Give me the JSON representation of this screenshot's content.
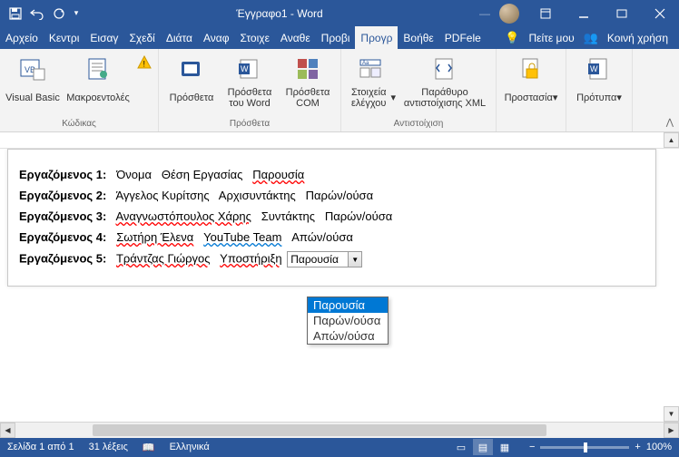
{
  "titlebar": {
    "title": "Έγγραφο1 - Word",
    "username": "—"
  },
  "tabs": [
    "Αρχείο",
    "Κεντρι",
    "Εισαγ",
    "Σχεδί",
    "Διάτα",
    "Αναφ",
    "Στοιχε",
    "Αναθε",
    "Προβι",
    "Προγρ",
    "Βοήθε",
    "PDFele"
  ],
  "activeTab": 9,
  "tell_me": "Πείτε μου",
  "share": "Κοινή χρήση",
  "ribbon": {
    "groups": [
      {
        "label": "Κώδικας",
        "buttons": [
          {
            "name": "visual-basic",
            "label": "Visual Basic"
          },
          {
            "name": "macros",
            "label": "Μακροεντολές"
          },
          {
            "name": "macro-security",
            "label": ""
          }
        ]
      },
      {
        "label": "Πρόσθετα",
        "buttons": [
          {
            "name": "addins",
            "label": "Πρόσθετα"
          },
          {
            "name": "word-addins",
            "label": "Πρόσθετα του Word"
          },
          {
            "name": "com-addins",
            "label": "Πρόσθετα COM"
          }
        ]
      },
      {
        "label": "Αντιστοίχιση",
        "buttons": [
          {
            "name": "controls",
            "label": "Στοιχεία ελέγχου"
          },
          {
            "name": "xml-mapping",
            "label": "Παράθυρο αντιστοίχισης XML"
          }
        ]
      },
      {
        "label": "",
        "buttons": [
          {
            "name": "protect",
            "label": "Προστασία"
          }
        ]
      },
      {
        "label": "",
        "buttons": [
          {
            "name": "templates",
            "label": "Πρότυπα"
          }
        ]
      }
    ]
  },
  "doc": {
    "rows": [
      {
        "label": "Εργαζόμενος 1:",
        "name": "Όνομα",
        "role": "Θέση Εργασίας",
        "status": "Παρουσία"
      },
      {
        "label": "Εργαζόμενος 2:",
        "name": "Άγγελος Κυρίτσης",
        "role": "Αρχισυντάκτης",
        "status": "Παρών/ούσα"
      },
      {
        "label": "Εργαζόμενος 3:",
        "name": "Αναγνωστόπουλος Χάρης",
        "role": "Συντάκτης",
        "status": "Παρών/ούσα"
      },
      {
        "label": "Εργαζόμενος 4:",
        "name": "Σωτήρη Έλενα",
        "role": "YouTube Team",
        "status": "Απών/ούσα"
      },
      {
        "label": "Εργαζόμενος 5:",
        "name": "Τράντζας Γιώργος",
        "role": "Υποστήριξη"
      }
    ],
    "combo_value": "Παρουσία",
    "dropdown": [
      "Παρουσία",
      "Παρών/ούσα",
      "Απών/ούσα"
    ],
    "dropdown_selected": 0
  },
  "status": {
    "page": "Σελίδα 1 από 1",
    "words": "31 λέξεις",
    "lang": "Ελληνικά",
    "zoom": "100%"
  }
}
